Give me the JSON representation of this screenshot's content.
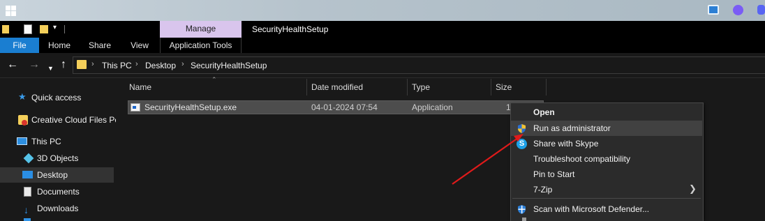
{
  "window": {
    "title": "SecurityHealthSetup",
    "manage_tab": "Manage"
  },
  "ribbon": {
    "tabs": [
      "File",
      "Home",
      "Share",
      "View",
      "Application Tools"
    ]
  },
  "breadcrumb": [
    "This PC",
    "Desktop",
    "SecurityHealthSetup"
  ],
  "navpane": {
    "items": [
      {
        "label": "Quick access",
        "icon": "star-icon"
      },
      {
        "label": "Creative Cloud Files Pe",
        "icon": "creative-cloud-folder-icon"
      },
      {
        "label": "This PC",
        "icon": "pc-icon"
      },
      {
        "label": "3D Objects",
        "icon": "3d-objects-icon"
      },
      {
        "label": "Desktop",
        "icon": "desktop-icon"
      },
      {
        "label": "Documents",
        "icon": "documents-icon"
      },
      {
        "label": "Downloads",
        "icon": "downloads-icon"
      }
    ]
  },
  "columns": [
    "Name",
    "Date modified",
    "Type",
    "Size"
  ],
  "files": [
    {
      "name": "SecurityHealthSetup.exe",
      "date": "04-01-2024 07:54",
      "type": "Application",
      "size": "1"
    }
  ],
  "context_menu": {
    "items": [
      {
        "label": "Open",
        "icon": "",
        "bold": true
      },
      {
        "label": "Run as administrator",
        "icon": "uac-shield-icon",
        "hover": true
      },
      {
        "label": "Share with Skype",
        "icon": "skype-icon"
      },
      {
        "label": "Troubleshoot compatibility",
        "icon": ""
      },
      {
        "label": "Pin to Start",
        "icon": ""
      },
      {
        "label": "7-Zip",
        "icon": "",
        "submenu": true
      },
      {
        "label": "Scan with Microsoft Defender...",
        "icon": "defender-shield-icon"
      }
    ]
  },
  "colors": {
    "file_tab": "#1a7ed1",
    "manage_tab": "#d9c5ed",
    "annotation_arrow": "#e01a1a"
  }
}
